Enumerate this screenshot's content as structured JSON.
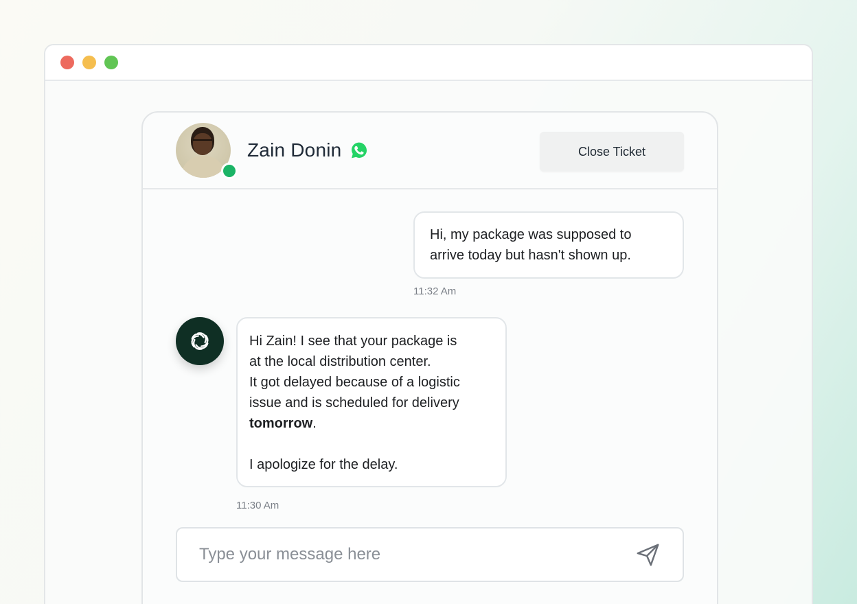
{
  "window": {
    "controls": [
      "close",
      "minimize",
      "maximize"
    ]
  },
  "header": {
    "contact_name": "Zain Donin",
    "channel_icon": "whatsapp-icon",
    "status": "online",
    "close_ticket_label": "Close Ticket"
  },
  "messages": [
    {
      "sender": "customer",
      "lines": [
        "Hi, my package was supposed to",
        "arrive today but hasn't shown up."
      ],
      "time": "11:32 Am"
    },
    {
      "sender": "agent",
      "avatar_icon": "openai-logo-icon",
      "lines": [
        "Hi Zain! I see that your package is",
        "at the local distribution center.",
        "It got delayed because of a logistic",
        "issue and is scheduled for delivery",
        "tomorrow",
        ".",
        "I apologize for the delay."
      ],
      "time": "11:30 Am"
    }
  ],
  "composer": {
    "placeholder": "Type your message here",
    "value": "",
    "send_icon": "send-icon"
  },
  "colors": {
    "online": "#1bb466",
    "bot_avatar": "#0f2f24",
    "whatsapp": "#25d366"
  }
}
